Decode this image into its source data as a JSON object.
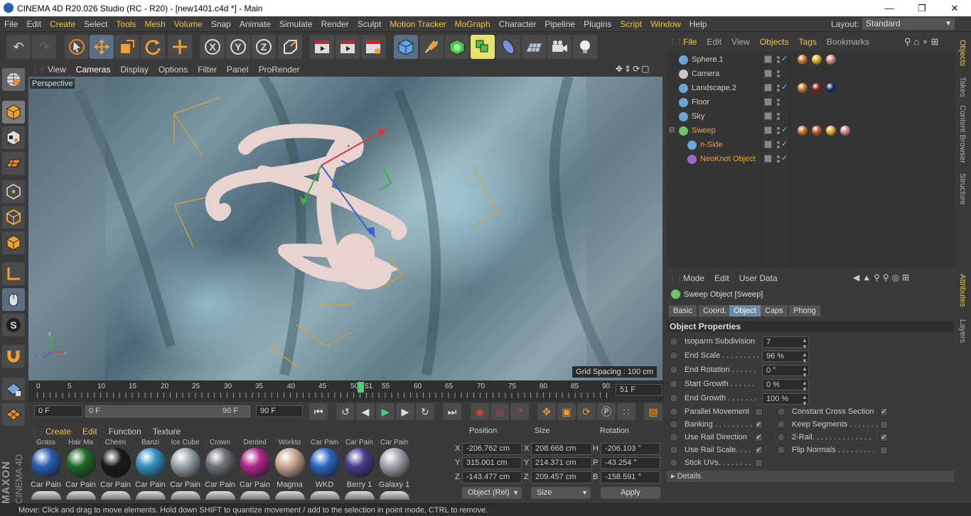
{
  "window": {
    "title": "CINEMA 4D R20.026 Studio (RC - R20) - [new1401.c4d *] - Main"
  },
  "menubar": [
    "File",
    "Edit",
    "Create",
    "Select",
    "Tools",
    "Mesh",
    "Volume",
    "Snap",
    "Animate",
    "Simulate",
    "Render",
    "Sculpt",
    "Motion Tracker",
    "MoGraph",
    "Character",
    "Pipeline",
    "Plugins",
    "Script",
    "Window",
    "Help"
  ],
  "layout": {
    "label": "Layout:",
    "value": "Standard"
  },
  "viewport": {
    "menu": [
      "View",
      "Cameras",
      "Display",
      "Options",
      "Filter",
      "Panel",
      "ProRender"
    ],
    "label": "Perspective",
    "grid_spacing": "Grid Spacing : 100 cm"
  },
  "timeline": {
    "ticks": [
      "0",
      "5",
      "10",
      "15",
      "20",
      "25",
      "30",
      "35",
      "40",
      "45",
      "50",
      "51",
      "55",
      "60",
      "65",
      "70",
      "75",
      "80",
      "85",
      "90"
    ],
    "current_frame": "51 F",
    "start_field": "0 F",
    "slider_start": "0 F",
    "slider_end": "90 F",
    "end_field": "90 F"
  },
  "materials": {
    "menu": [
      "Create",
      "Edit",
      "Function",
      "Texture"
    ],
    "row1": [
      {
        "top": "Grass",
        "name": "Car Pain",
        "color": "#2a5db0"
      },
      {
        "top": "Hair Ma",
        "name": "Car Pain",
        "color": "#1e6b2a"
      },
      {
        "top": "Cheen",
        "name": "Car Pain",
        "color": "#1a1a1a"
      },
      {
        "top": "Banzi",
        "name": "Car Pain",
        "color": "#3590c0"
      },
      {
        "top": "Ice Cube",
        "name": "Car Pain",
        "color": "#9aa3ab"
      },
      {
        "top": "Crown",
        "name": "Car Pain",
        "color": "#6e7378"
      },
      {
        "top": "Dented",
        "name": "Car Pain",
        "color": "#b0268a"
      },
      {
        "top": "Workto",
        "name": "Magma",
        "color": "#c9a894"
      },
      {
        "top": "Car Pain",
        "name": "WKD",
        "color": "#2a66c0"
      },
      {
        "top": "Car Pain",
        "name": "Berry 1",
        "color": "#4a3a8a"
      },
      {
        "top": "Car Pain",
        "name": "Galaxy 1",
        "color": "#a0a4ac"
      }
    ]
  },
  "coordinates": {
    "headers": [
      "Position",
      "Size",
      "Rotation"
    ],
    "rows": [
      {
        "axis": "X",
        "pos": "-206.762 cm",
        "saxis": "X",
        "size": "208.668 cm",
        "raxis": "H",
        "rot": "-206.103 °"
      },
      {
        "axis": "Y",
        "pos": "315.001 cm",
        "saxis": "Y",
        "size": "214.371 cm",
        "raxis": "P",
        "rot": "-43.254 °"
      },
      {
        "axis": "Z",
        "pos": "-143.477 cm",
        "saxis": "Z",
        "size": "209.457 cm",
        "raxis": "B",
        "rot": "-158.591 °"
      }
    ],
    "mode": "Object (Rel)",
    "size_mode": "Size",
    "apply": "Apply"
  },
  "object_manager": {
    "menu": [
      "File",
      "Edit",
      "View",
      "Objects",
      "Tags",
      "Bookmarks"
    ],
    "objects": [
      {
        "name": "Sphere.1",
        "icon": "#6aa6d8",
        "tags": [
          "#c87a2a",
          "#d9b028",
          "#d48a8a"
        ]
      },
      {
        "name": "Camera",
        "icon": "#c8c8c8",
        "tags": []
      },
      {
        "name": "Landscape.2",
        "icon": "#6aa6d8",
        "tags": [
          "#c87a2a",
          "#8a1f1f",
          "#1a2a66"
        ]
      },
      {
        "name": "Floor",
        "icon": "#6aa6d8",
        "tags": []
      },
      {
        "name": "Sky",
        "icon": "#6aa6d8",
        "tags": []
      },
      {
        "name": "Sweep",
        "icon": "#6ec26e",
        "tags": [
          "#c87a2a",
          "#c85a3a",
          "#d9b028",
          "#d48a8a"
        ]
      },
      {
        "name": "n-Side",
        "icon": "#6aa6d8",
        "tags": []
      },
      {
        "name": "NeoKnot Object",
        "icon": "#a068c8",
        "tags": []
      }
    ]
  },
  "right_tabs": [
    "Objects",
    "Takes",
    "Content Browser",
    "Structure",
    "Attributes",
    "Layers"
  ],
  "attributes": {
    "menu": [
      "Mode",
      "Edit",
      "User Data"
    ],
    "title": "Sweep Object [Sweep]",
    "tabs": [
      "Basic",
      "Coord.",
      "Object",
      "Caps",
      "Phong"
    ],
    "section": "Object Properties",
    "fields": [
      {
        "label": "Isoparm Subdivision",
        "value": "7"
      },
      {
        "label": "End Scale . . . . . . . . .",
        "value": "96 %"
      },
      {
        "label": "End Rotation . . . . . .",
        "value": "0 °"
      },
      {
        "label": "Start Growth . . . . . .",
        "value": "0 %"
      },
      {
        "label": "End Growth . . . . . . .",
        "value": "100 %"
      }
    ],
    "checks_left": [
      {
        "label": "Parallel Movement",
        "checked": false
      },
      {
        "label": "Banking . . . . . . . . .",
        "checked": true
      },
      {
        "label": "Use Rail Direction",
        "checked": true
      },
      {
        "label": "Use Rail Scale. . . .",
        "checked": true
      },
      {
        "label": "Stick UVs. . . . . . . .",
        "checked": false
      }
    ],
    "checks_right": [
      {
        "label": "Constant Cross Section",
        "checked": true
      },
      {
        "label": "Keep Segments . . . . . . .",
        "checked": false
      },
      {
        "label": "2-Rail. . . . . . . . . . . . . .",
        "checked": true
      },
      {
        "label": "Flip Normals . . . . . . . . .",
        "checked": false
      }
    ],
    "details": "Details",
    "check_glyph": "✓"
  },
  "brand": {
    "maxon": "MAXON",
    "cinema": "CINEMA 4D"
  },
  "status": "Move: Click and drag to move elements. Hold down SHIFT to quantize movement / add to the selection in point mode, CTRL to remove."
}
